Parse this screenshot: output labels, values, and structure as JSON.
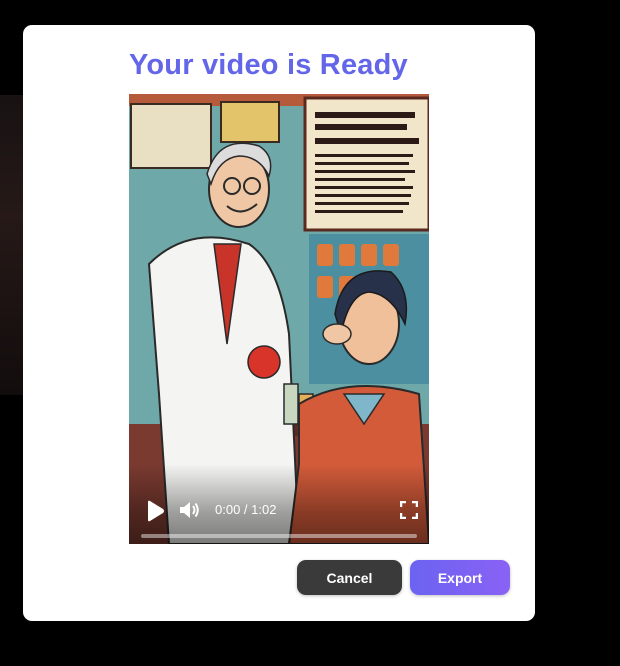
{
  "modal": {
    "title": "Your video is Ready"
  },
  "video": {
    "time_display": "0:00 / 1:02",
    "progress": 0,
    "icons": {
      "play": "play-icon",
      "volume": "volume-icon",
      "fullscreen": "fullscreen-icon"
    }
  },
  "actions": {
    "cancel_label": "Cancel",
    "export_label": "Export"
  },
  "colors": {
    "title": "#6366e8",
    "cancel_bg": "#3a3a3a",
    "export_bg": "#6b63f2"
  }
}
